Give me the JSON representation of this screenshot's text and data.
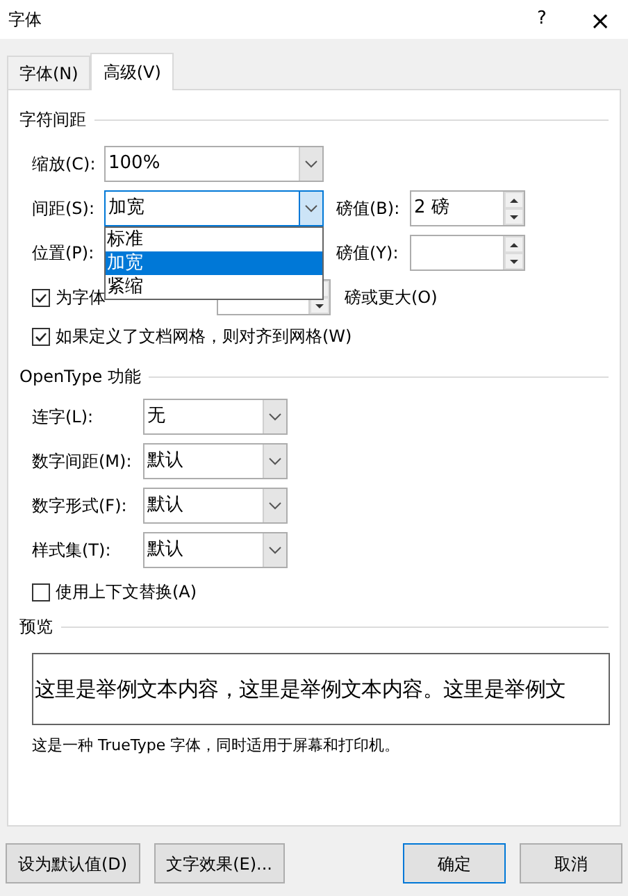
{
  "window": {
    "title": "字体",
    "help_button": "?",
    "close_button": "×"
  },
  "tabs": [
    {
      "label": "字体(N)",
      "selected": false
    },
    {
      "label": "高级(V)",
      "selected": true
    }
  ],
  "character_spacing": {
    "title": "字符间距",
    "scale": {
      "label": "缩放(C):",
      "value": "100%"
    },
    "spacing": {
      "label": "间距(S):",
      "value": "加宽",
      "expanded": true,
      "options": [
        {
          "label": "标准",
          "selected": false
        },
        {
          "label": "加宽",
          "selected": true
        },
        {
          "label": "紧缩",
          "selected": false
        }
      ]
    },
    "spacing_by": {
      "label": "磅值(B):",
      "value": "2 磅"
    },
    "position": {
      "label": "位置(P):"
    },
    "position_by": {
      "label": "磅值(Y):"
    },
    "kerning": {
      "label": "为字体",
      "checked": true,
      "suffix": "磅或更大(O)"
    },
    "snap_to_grid": {
      "label": "如果定义了文档网格，则对齐到网格(W)",
      "checked": true
    }
  },
  "opentype": {
    "title": "OpenType 功能",
    "combos": [
      {
        "label": "连字(L):",
        "value": "无"
      },
      {
        "label": "数字间距(M):",
        "value": "默认"
      },
      {
        "label": "数字形式(F):",
        "value": "默认"
      },
      {
        "label": "样式集(T):",
        "value": "默认"
      }
    ],
    "contextual": {
      "label": "使用上下文替换(A)",
      "checked": false
    }
  },
  "preview": {
    "title": "预览",
    "sample": "这里是举例文本内容，这里是举例文本内容。这里是举例文",
    "note": "这是一种 TrueType 字体，同时适用于屏幕和打印机。"
  },
  "buttons": [
    {
      "label": "设为默认值(D)",
      "focused": false
    },
    {
      "label": "文字效果(E)...",
      "focused": false
    },
    {
      "label": "确定",
      "focused": true
    },
    {
      "label": "取消",
      "focused": false
    }
  ]
}
